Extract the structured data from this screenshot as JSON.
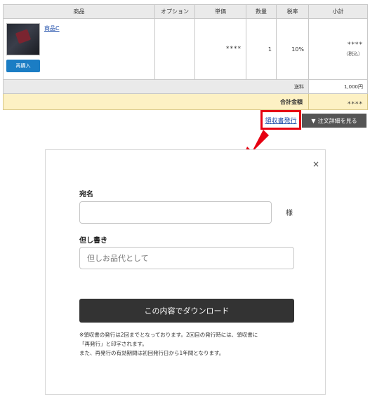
{
  "table": {
    "headers": [
      "商品",
      "オプション",
      "単価",
      "数量",
      "税率",
      "小計"
    ],
    "item": {
      "name": "商品C",
      "rebuy_label": "再購入",
      "option": "",
      "unit_price": "****",
      "quantity": "1",
      "tax_rate": "10%",
      "subtotal": "****",
      "tax_note": "（税込）"
    },
    "shipping_label": "送料",
    "shipping_value": "1,000円",
    "total_label": "合計金額",
    "total_value": "****"
  },
  "actions": {
    "receipt_link": "領収書発行",
    "order_detail_label": "注文詳細を見る",
    "order_detail_arrow": "▼"
  },
  "modal": {
    "close_symbol": "×",
    "name_label": "宛名",
    "name_value": "",
    "honorific": "様",
    "note_label": "但し書き",
    "note_placeholder": "但しお品代として",
    "download_label": "この内容でダウンロード",
    "notes": [
      "※領収書の発行は2回までとなっております。2回目の発行時には、領収書に",
      "「再発行」と印字されます。",
      "また、再発行の有効期間は初回発行日から1年間となります。"
    ]
  },
  "colors": {
    "accent_red": "#e60012",
    "link_blue": "#1a4aa8",
    "rebuy_blue": "#1b7dc4",
    "total_bg": "#fdf1c4",
    "download_bg": "#333333"
  },
  "icons": [
    "close-icon",
    "red-arrow-icon",
    "triangle-down-icon"
  ]
}
